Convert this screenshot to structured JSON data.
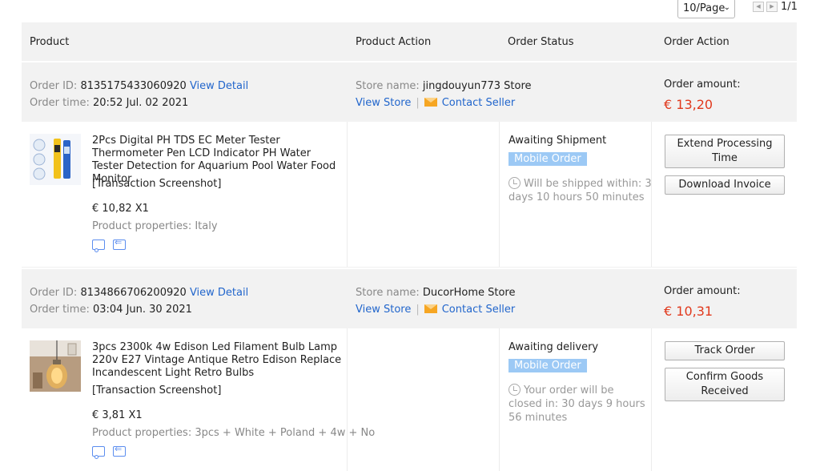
{
  "pager": {
    "per_page": "10/Page",
    "page_count": "1/1"
  },
  "columns": {
    "product": "Product",
    "product_action": "Product Action",
    "order_status": "Order Status",
    "order_action": "Order Action"
  },
  "orders": [
    {
      "order_id_label": "Order ID:",
      "order_id": "8135175433060920",
      "view_detail": "View Detail",
      "order_time_label": "Order time:",
      "order_time": "20:52 Jul. 02 2021",
      "store_label": "Store name:",
      "store_name": "jingdouyun773 Store",
      "view_store": "View Store",
      "contact_seller": "Contact Seller",
      "amount_label": "Order amount:",
      "amount": "€ 13,20",
      "product_title": "2Pcs Digital PH TDS EC Meter Tester Thermometer Pen LCD Indicator PH Water Tester Detection for Aquarium Pool Water Food Monitor",
      "snapshot": "[Transaction Screenshot]",
      "price": "€ 10,82 X1",
      "properties": "Product properties: Italy",
      "status": "Awaiting Shipment",
      "badge": "Mobile Order",
      "status_note": "Will be shipped within: 3 days 10 hours 50 minutes",
      "buttons": [
        "Extend Processing Time",
        "Download Invoice"
      ]
    },
    {
      "order_id_label": "Order ID:",
      "order_id": "8134866706200920",
      "view_detail": "View Detail",
      "order_time_label": "Order time:",
      "order_time": "03:04 Jun. 30 2021",
      "store_label": "Store name:",
      "store_name": "DucorHome Store",
      "view_store": "View Store",
      "contact_seller": "Contact Seller",
      "amount_label": "Order amount:",
      "amount": "€ 10,31",
      "product_title": "3pcs 2300k 4w Edison Led Filament Bulb Lamp 220v E27 Vintage Antique Retro Edison Replace Incandescent Light Retro Bulbs",
      "snapshot": "[Transaction Screenshot]",
      "price": "€ 3,81 X1",
      "properties": "Product properties: 3pcs + White + Poland + 4w + No",
      "status": "Awaiting delivery",
      "badge": "Mobile Order",
      "status_note": "Your order will be closed in: 30 days 9 hours 56 minutes",
      "buttons": [
        "Track Order",
        "Confirm Goods Received"
      ]
    }
  ],
  "colors": {
    "link": "#2266cc",
    "amount": "#e1391d",
    "badge": "#9cc9f5",
    "header_bg": "#f2f2f2"
  }
}
